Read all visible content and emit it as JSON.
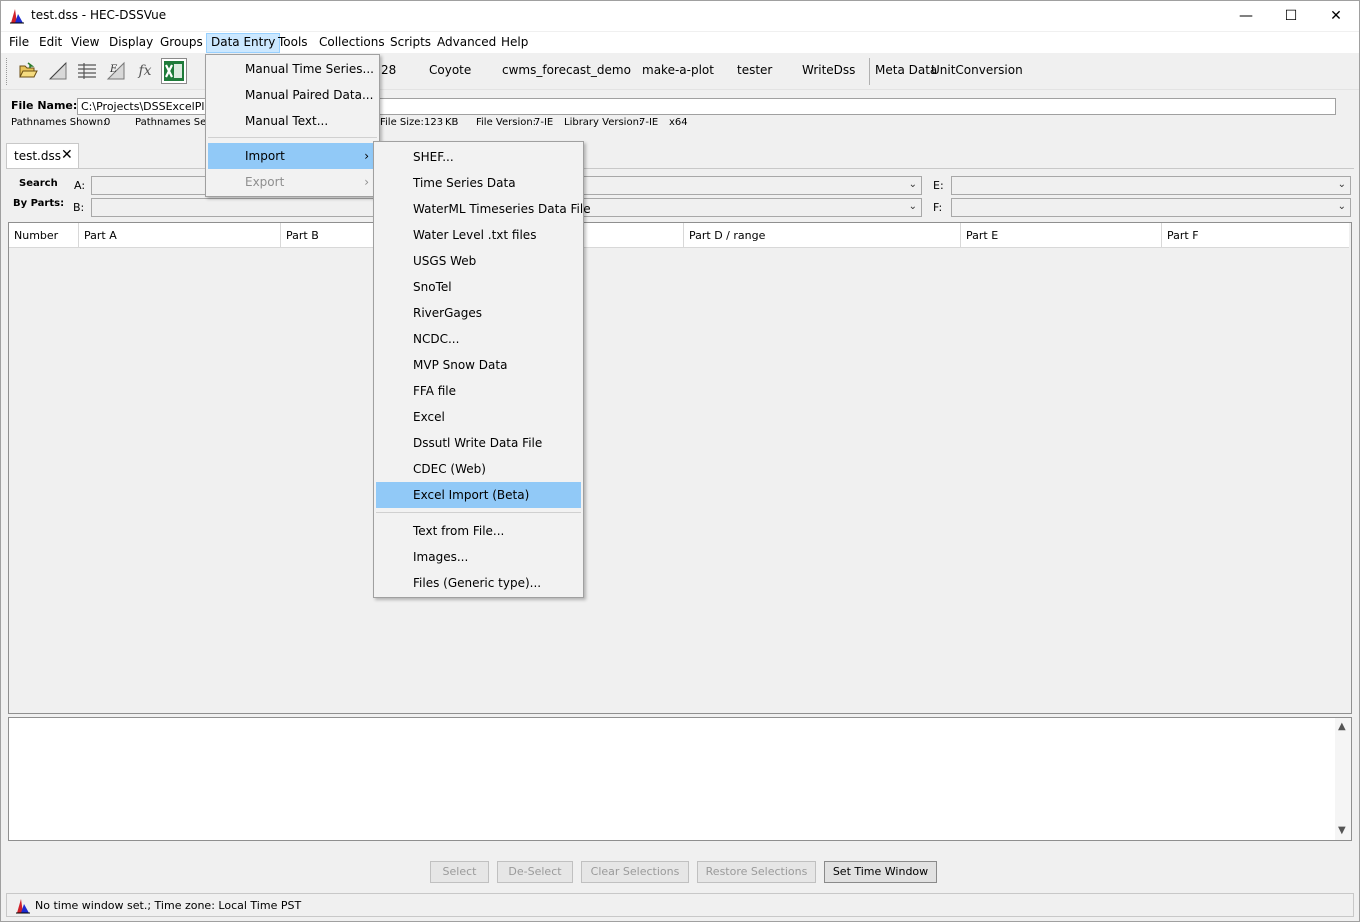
{
  "window": {
    "title": "test.dss - HEC-DSSVue",
    "minimize_glyph": "—",
    "maximize_glyph": "☐",
    "close_glyph": "✕"
  },
  "menubar": {
    "items": [
      "File",
      "Edit",
      "View",
      "Display",
      "Groups",
      "Data Entry",
      "Tools",
      "Collections",
      "Scripts",
      "Advanced",
      "Help"
    ],
    "active": "Data Entry"
  },
  "toolbar": {
    "icons": [
      "open-folder-icon",
      "plot-icon",
      "tabulate-icon",
      "edit-icon",
      "math-functions-icon",
      "excel-icon"
    ],
    "math_glyph": "fx",
    "scripts": [
      "28",
      "Coyote",
      "cwms_forecast_demo",
      "make-a-plot",
      "tester",
      "WriteDss"
    ],
    "meta_data": "Meta Data",
    "unit_conversion": "UnitConversion"
  },
  "file_info": {
    "file_name_label": "File Name:",
    "file_name_value": "C:\\Projects\\DSSExcelPlugi",
    "pathnames_shown_label": "Pathnames Shown:",
    "pathnames_shown_value": "0",
    "pathnames_selected_label": "Pathnames Sele",
    "file_size_label": "File Size:",
    "file_size_value": "123",
    "file_size_unit": "KB",
    "file_version_label": "File Version:",
    "file_version_value": "7-IE",
    "library_version_label": "Library Version:",
    "library_version_value": "7-IE",
    "arch": "x64"
  },
  "tab": {
    "label": "test.dss",
    "close_glyph": "✕"
  },
  "search": {
    "label_line1": "Search",
    "label_line2": "By Parts:",
    "part_a": "A:",
    "part_b": "B:",
    "part_e": "E:",
    "part_f": "F:"
  },
  "table": {
    "columns": [
      "Number",
      "Part A",
      "Part B",
      "Part D / range",
      "Part E",
      "Part F"
    ]
  },
  "buttons": {
    "select": "Select",
    "deselect": "De-Select",
    "clear": "Clear Selections",
    "restore": "Restore Selections",
    "time_window": "Set Time Window"
  },
  "status": {
    "text": "No time window set.;  Time zone: Local Time PST"
  },
  "data_entry_menu": {
    "items": [
      {
        "label": "Manual Time Series...",
        "enabled": true
      },
      {
        "label": "Manual Paired Data...",
        "enabled": true
      },
      {
        "label": "Manual Text...",
        "enabled": true
      },
      {
        "label": "Import",
        "enabled": true,
        "submenu": true,
        "highlighted": true
      },
      {
        "label": "Export",
        "enabled": false,
        "submenu": true
      }
    ],
    "submenu_glyph": "›"
  },
  "import_submenu": {
    "items": [
      "SHEF...",
      "Time Series Data",
      "WaterML Timeseries Data File",
      "Water Level .txt files",
      "USGS Web",
      "SnoTel",
      "RiverGages",
      "NCDC...",
      "MVP Snow Data",
      "FFA file",
      "Excel",
      "Dssutl Write Data File",
      "CDEC (Web)",
      "Excel Import (Beta)"
    ],
    "highlighted": "Excel Import (Beta)",
    "extra_items": [
      "Text from File...",
      "Images...",
      "Files (Generic type)..."
    ]
  },
  "colors": {
    "menu_highlight": "#91c9f7",
    "menubar_active": "#cce8ff",
    "excel_green": "#1e7b3a",
    "logo_red": "#d0202a",
    "logo_blue": "#1d2bd0"
  }
}
